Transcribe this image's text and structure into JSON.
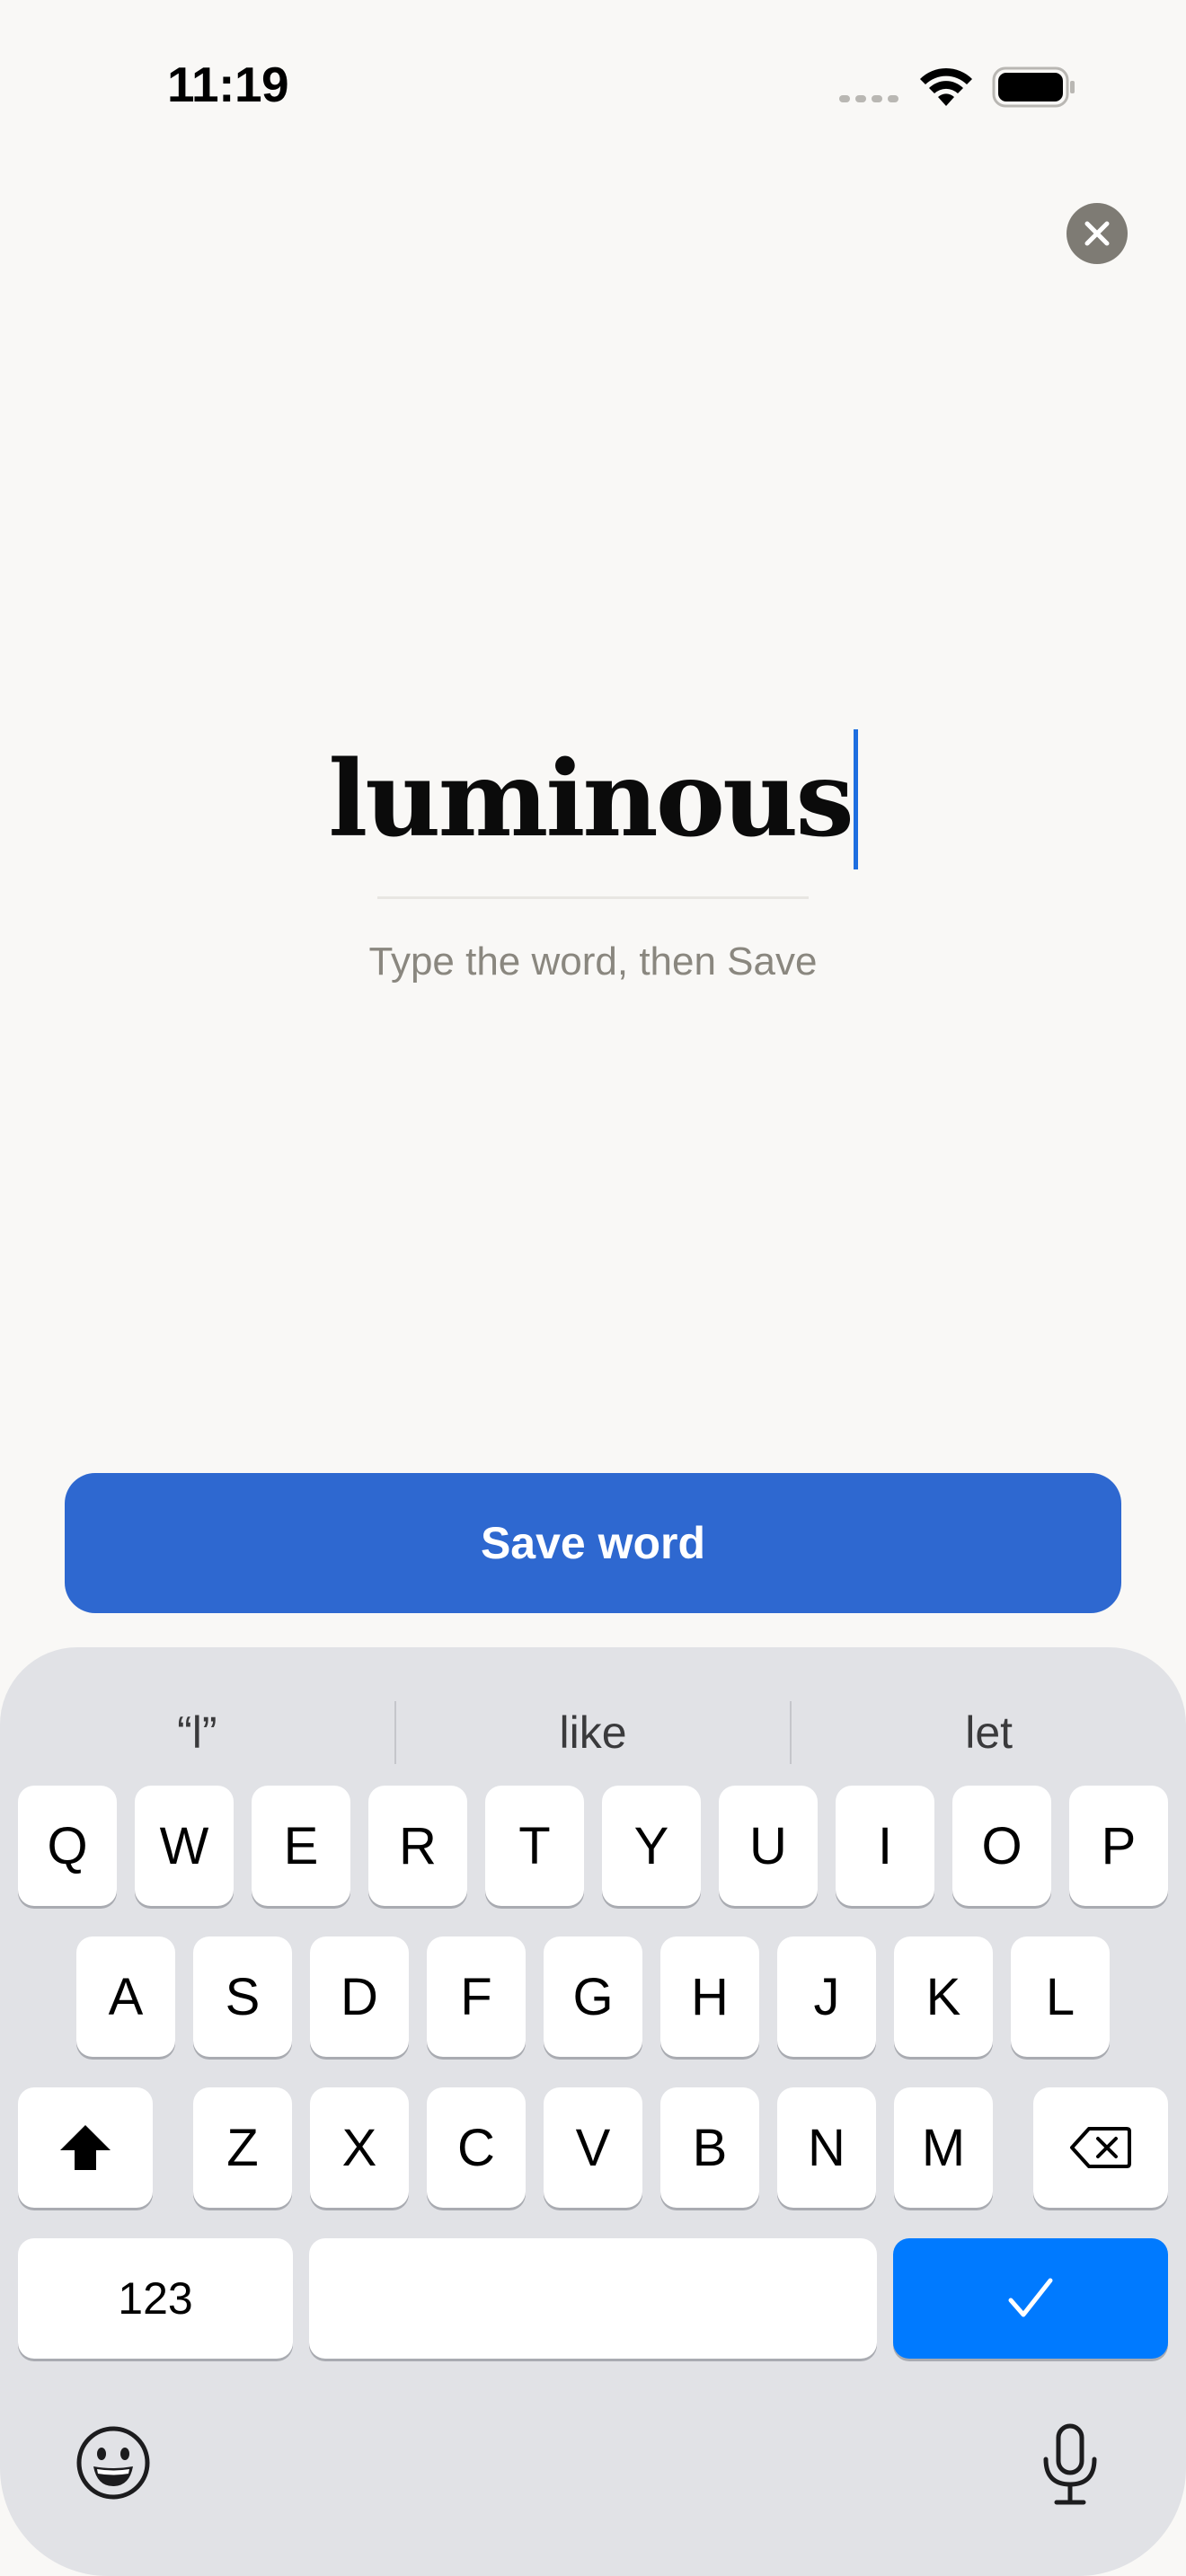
{
  "status_bar": {
    "time": "11:19"
  },
  "editor": {
    "word": "luminous",
    "hint": "Type the word, then Save"
  },
  "actions": {
    "save_label": "Save word"
  },
  "keyboard": {
    "suggestions": [
      "“l”",
      "like",
      "let"
    ],
    "row1": [
      "Q",
      "W",
      "E",
      "R",
      "T",
      "Y",
      "U",
      "I",
      "O",
      "P"
    ],
    "row2": [
      "A",
      "S",
      "D",
      "F",
      "G",
      "H",
      "J",
      "K",
      "L"
    ],
    "row3": [
      "Z",
      "X",
      "C",
      "V",
      "B",
      "N",
      "M"
    ],
    "numbers_label": "123",
    "done_key": "checkmark",
    "colors": {
      "background": "#e1e2e6",
      "key": "#ffffff",
      "done_key": "#007aff"
    }
  },
  "colors": {
    "save_button": "#2e68d0",
    "caret": "#1e6fe0",
    "page_background": "#f9f8f6"
  },
  "icons": [
    "signal-icon",
    "wifi-icon",
    "battery-icon",
    "close-icon",
    "shift-icon",
    "delete-icon",
    "checkmark-icon",
    "emoji-icon",
    "microphone-icon"
  ]
}
